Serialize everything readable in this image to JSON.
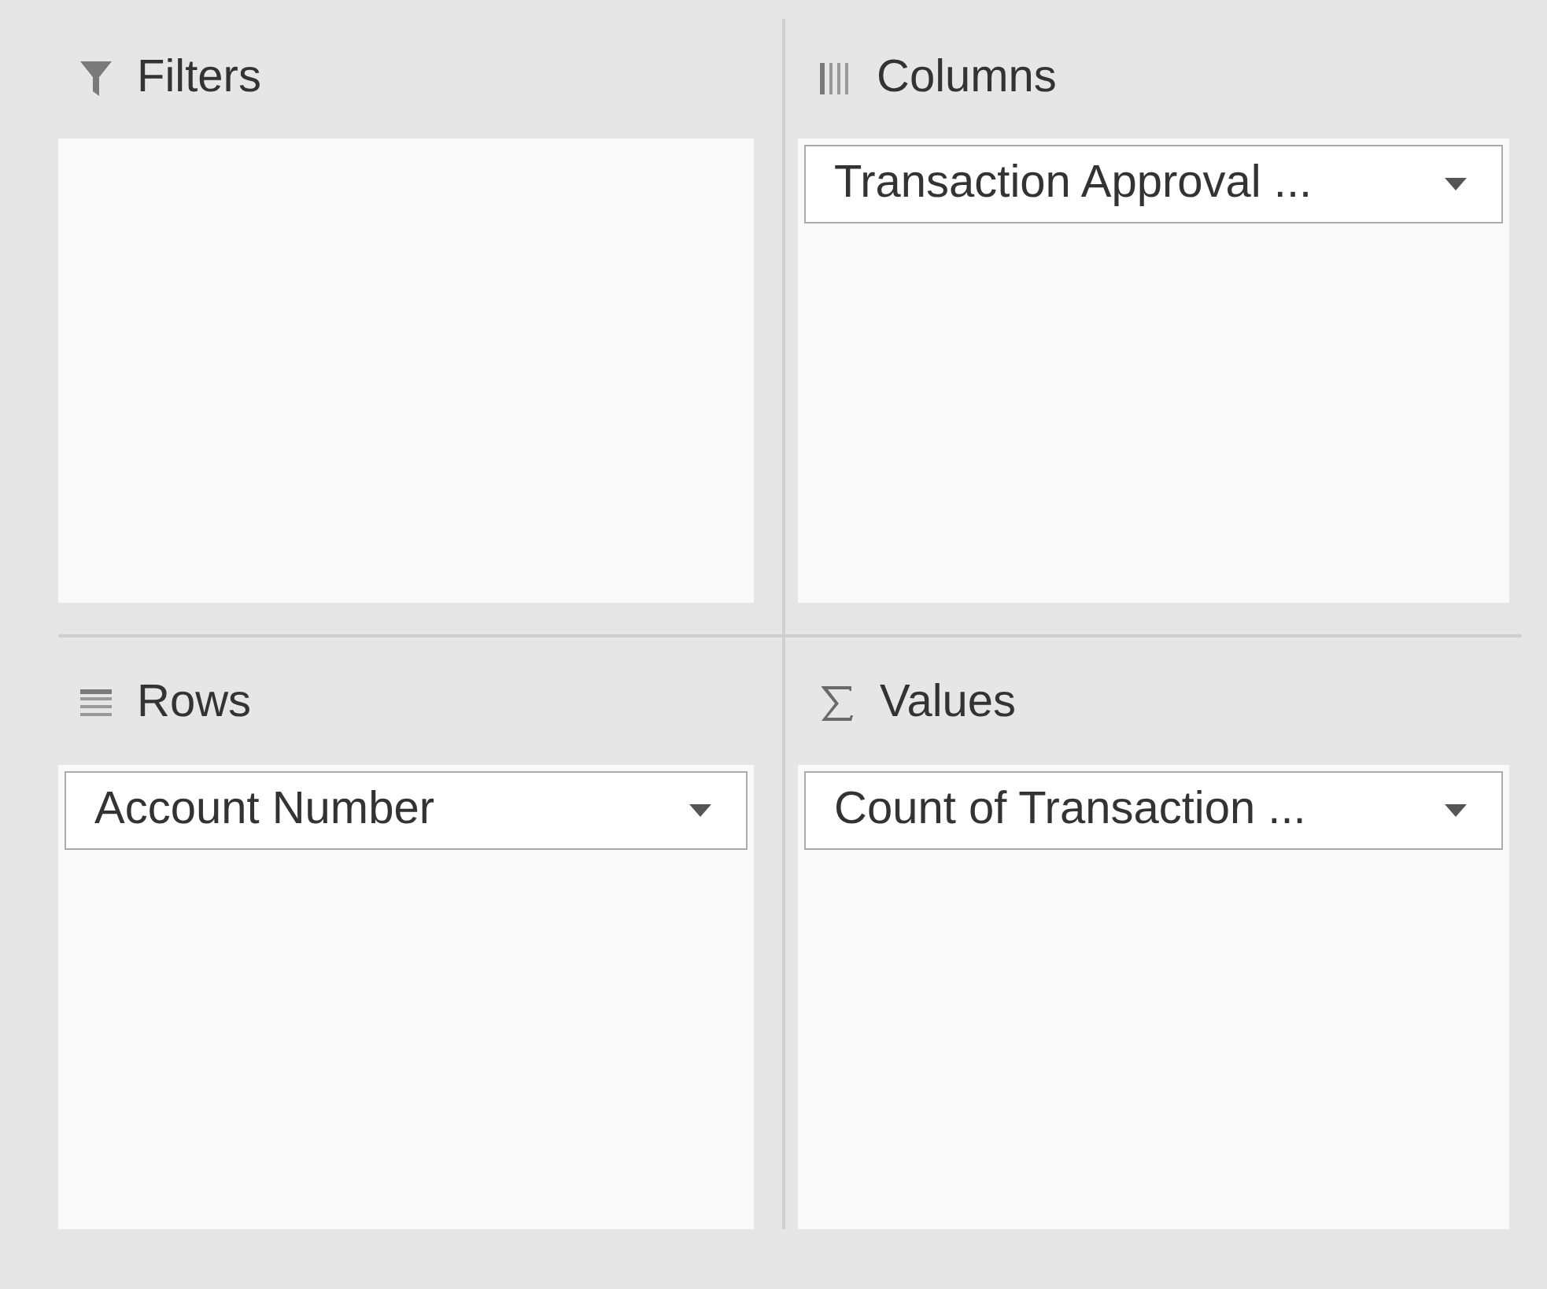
{
  "areas": [
    {
      "kind": "filters",
      "title": "Filters"
    },
    {
      "kind": "columns",
      "title": "Columns",
      "fields": [
        {
          "label": "Transaction Approval ..."
        }
      ]
    },
    {
      "kind": "rows",
      "title": "Rows",
      "fields": [
        {
          "label": "Account Number"
        }
      ]
    },
    {
      "kind": "values",
      "title": "Values",
      "fields": [
        {
          "label": "Count of Transaction ..."
        }
      ]
    }
  ]
}
